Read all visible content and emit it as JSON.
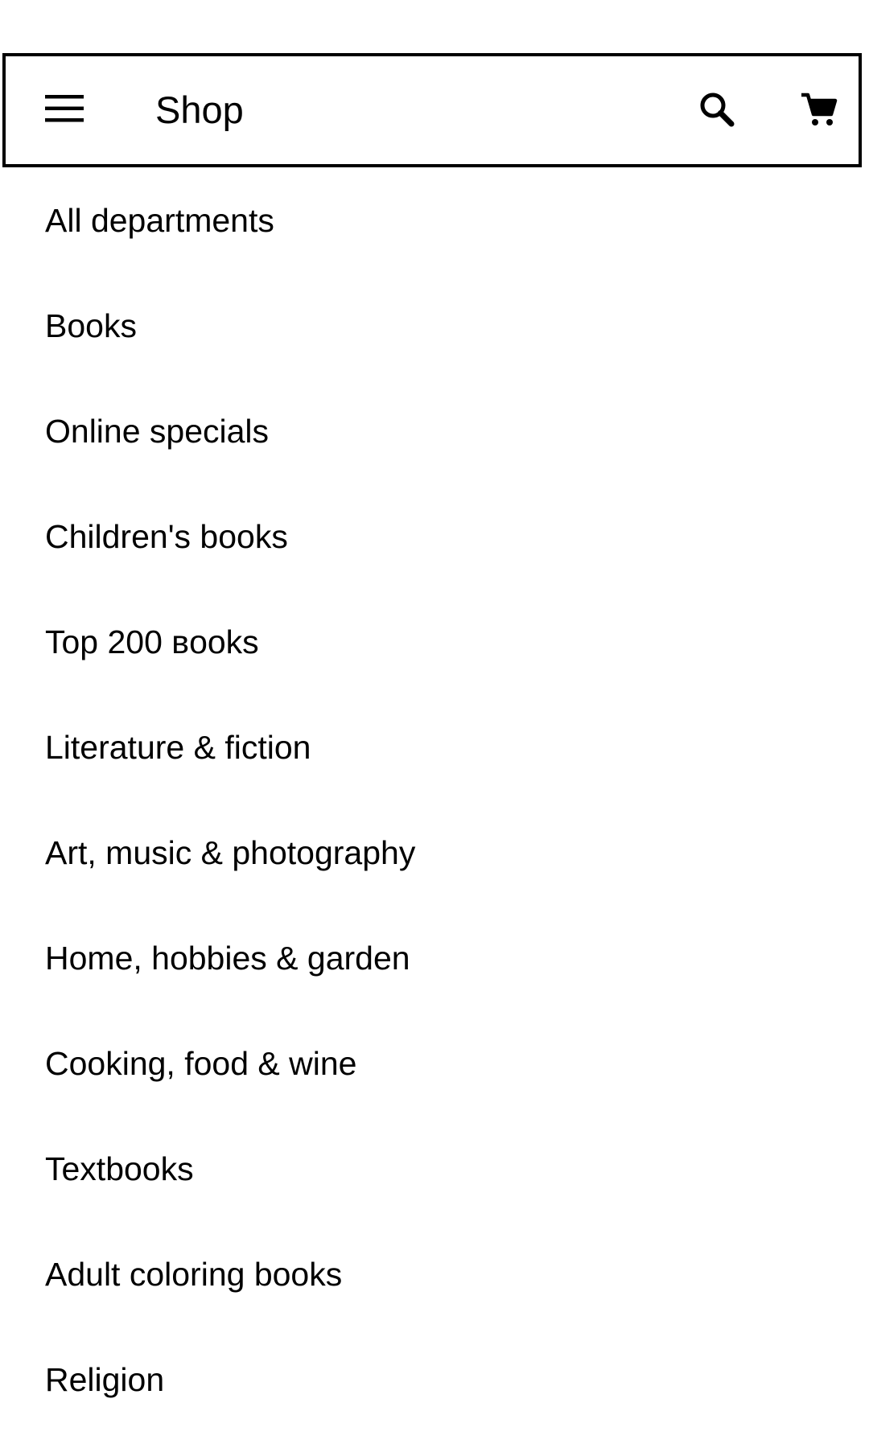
{
  "app_bar": {
    "menu_icon": "hamburger-menu-icon",
    "title": "Shop",
    "search_icon": "search-icon",
    "cart_icon": "shopping-cart-icon"
  },
  "departments": [
    {
      "label": "All departments"
    },
    {
      "label": "Books"
    },
    {
      "label": "Online specials"
    },
    {
      "label": "Children's books"
    },
    {
      "label": "Top 200 вooks"
    },
    {
      "label": "Literature & fiction"
    },
    {
      "label": "Art, music & photography"
    },
    {
      "label": "Home, hobbies & garden"
    },
    {
      "label": "Cooking, food & wine"
    },
    {
      "label": "Textbooks"
    },
    {
      "label": "Adult coloring books"
    },
    {
      "label": "Religion"
    }
  ],
  "colors": {
    "background": "#ffffff",
    "text": "#000000",
    "border": "#000000"
  }
}
